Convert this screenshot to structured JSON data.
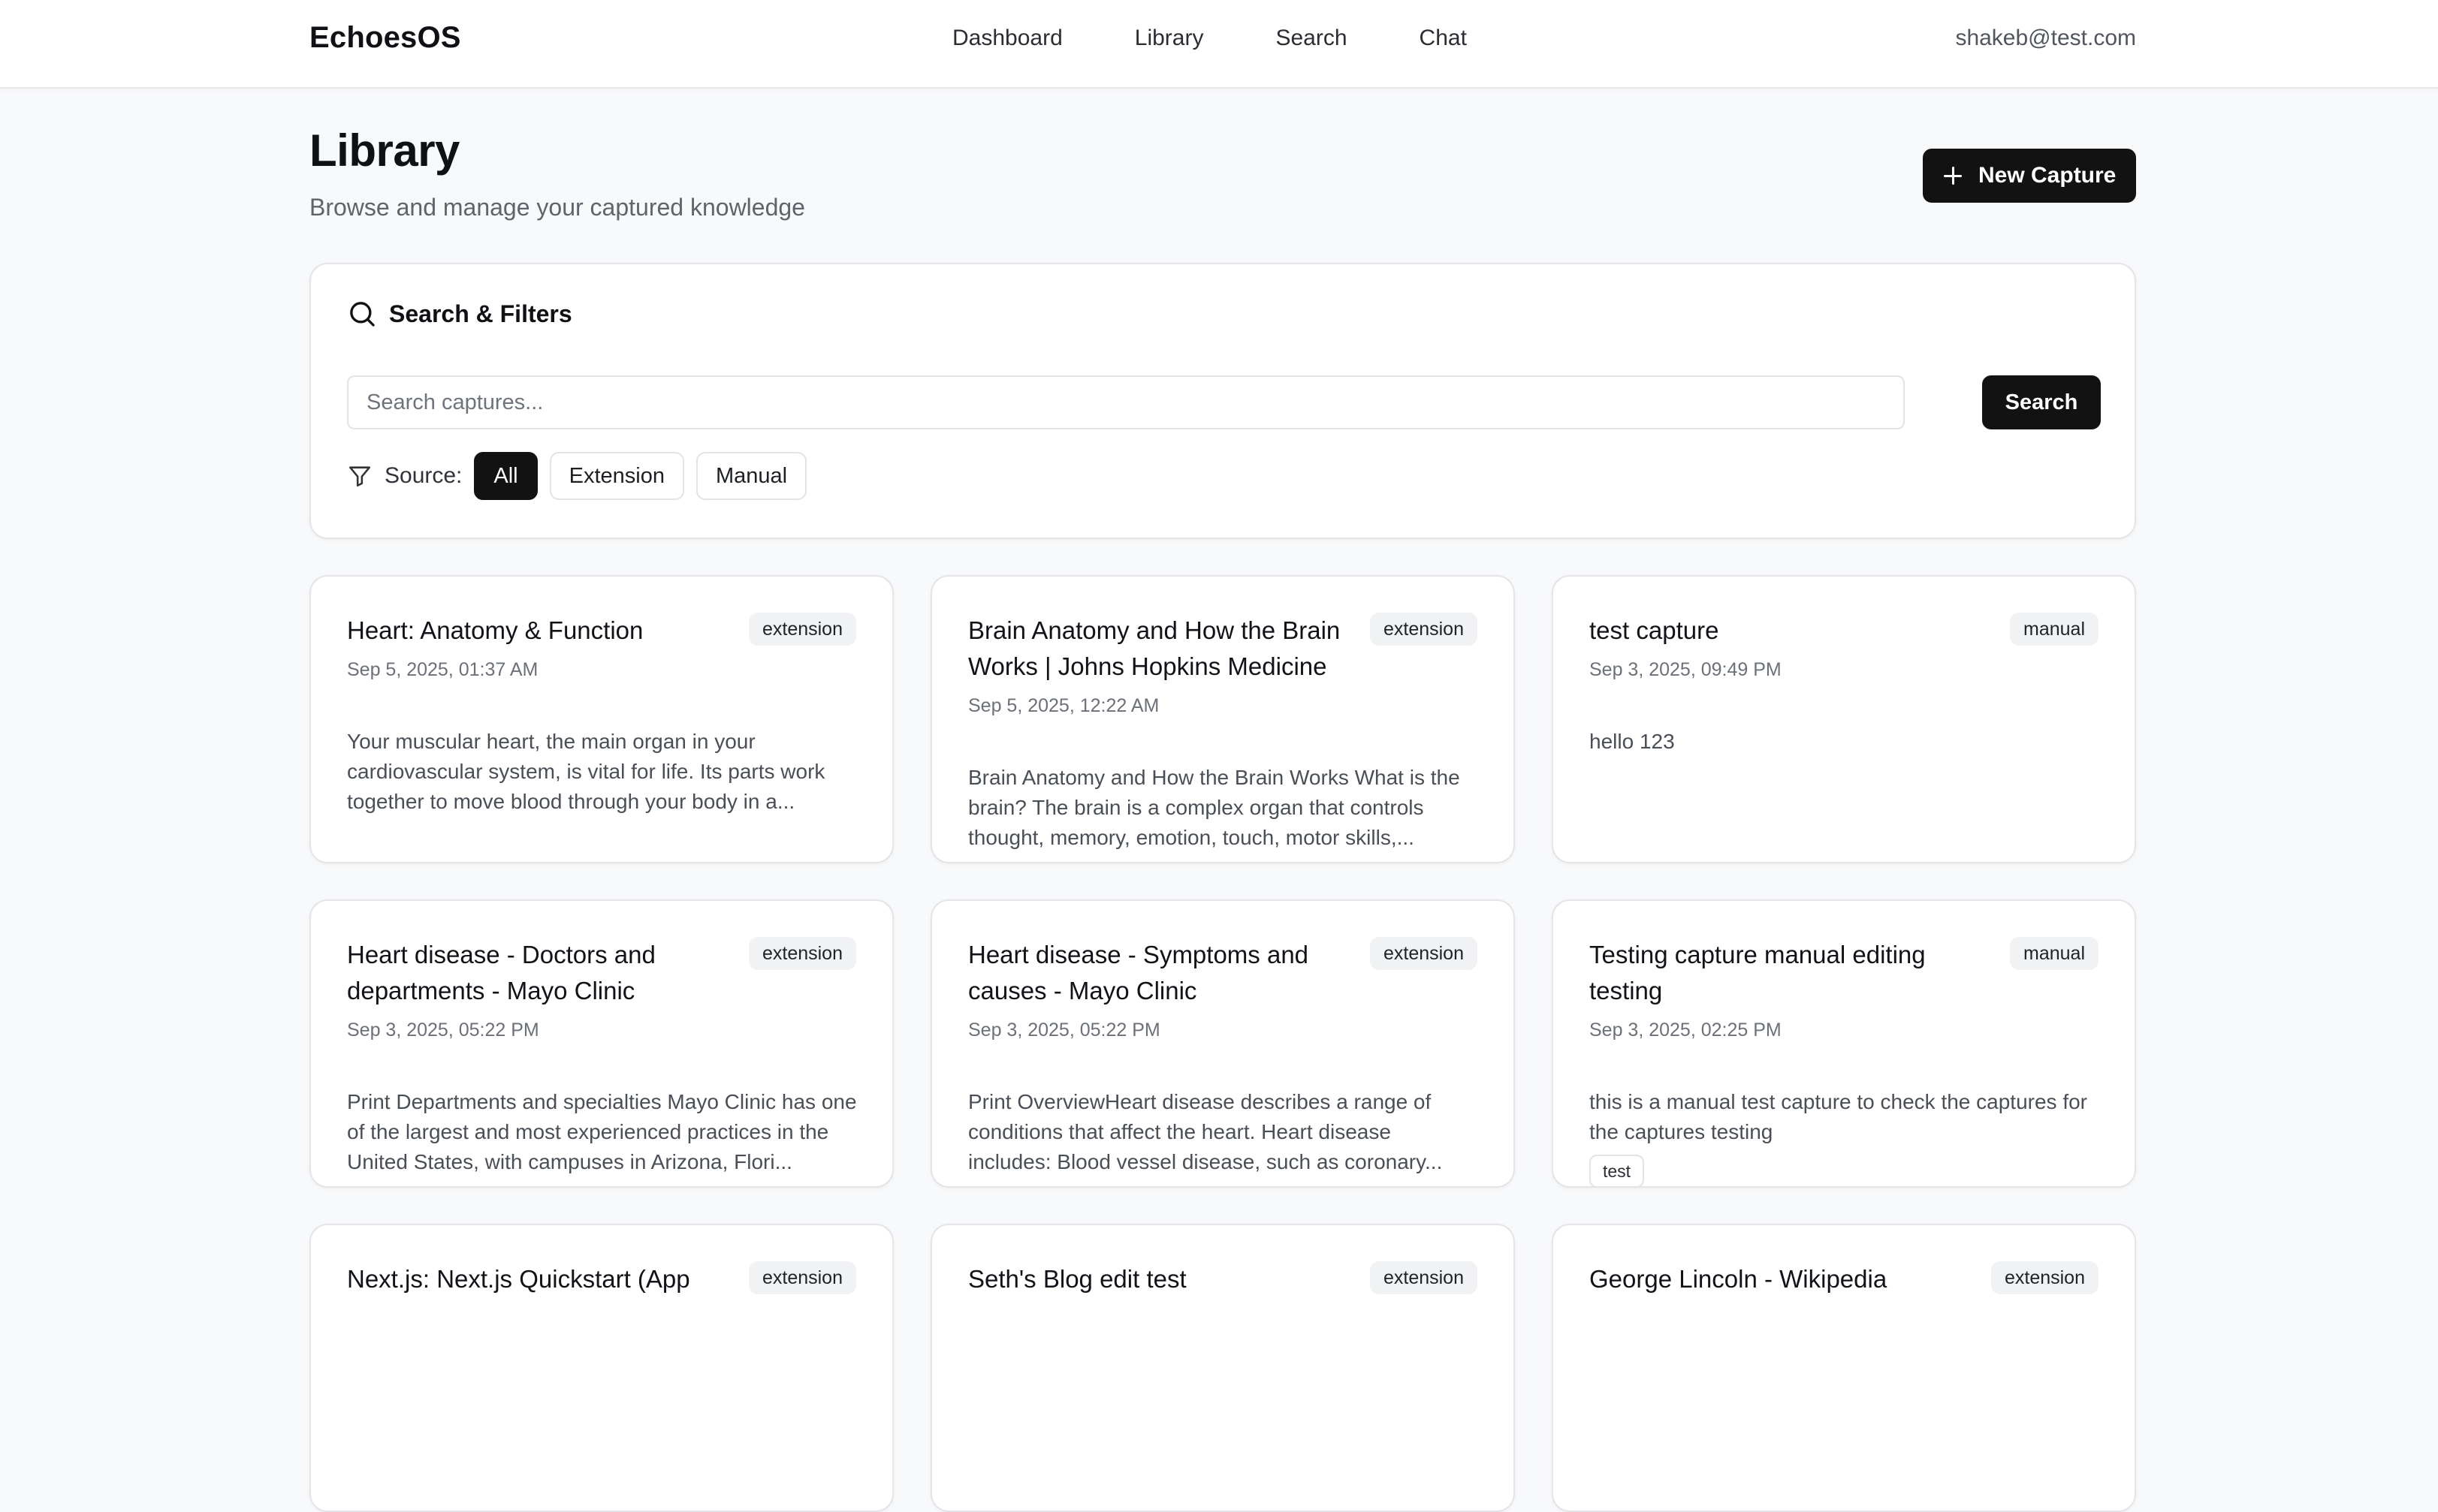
{
  "app": {
    "brand": "EchoesOS",
    "nav": [
      "Dashboard",
      "Library",
      "Search",
      "Chat"
    ],
    "user_email": "shakeb@test.com"
  },
  "page": {
    "title": "Library",
    "subtitle": "Browse and manage your captured knowledge",
    "new_capture_label": "New Capture"
  },
  "filters": {
    "title": "Search & Filters",
    "search_placeholder": "Search captures...",
    "search_button": "Search",
    "source_label": "Source:",
    "sources": [
      "All",
      "Extension",
      "Manual"
    ],
    "active_source": "All"
  },
  "captures": [
    {
      "title": "Heart: Anatomy & Function",
      "source": "extension",
      "date": "Sep 5, 2025, 01:37 AM",
      "excerpt": "Your muscular heart, the main organ in your cardiovascular system, is vital for life. Its parts work together to move blood through your body in a..."
    },
    {
      "title": "Brain Anatomy and How the Brain Works | Johns Hopkins Medicine",
      "source": "extension",
      "date": "Sep 5, 2025, 12:22 AM",
      "excerpt": "Brain Anatomy and How the Brain Works What is the brain? The brain is a complex organ that controls thought, memory, emotion, touch, motor skills,..."
    },
    {
      "title": "test capture",
      "source": "manual",
      "date": "Sep 3, 2025, 09:49 PM",
      "excerpt": "hello 123"
    },
    {
      "title": "Heart disease - Doctors and departments - Mayo Clinic",
      "source": "extension",
      "date": "Sep 3, 2025, 05:22 PM",
      "excerpt": "Print Departments and specialties Mayo Clinic has one of the largest and most experienced practices in the United States, with campuses in Arizona, Flori..."
    },
    {
      "title": "Heart disease - Symptoms and causes - Mayo Clinic",
      "source": "extension",
      "date": "Sep 3, 2025, 05:22 PM",
      "excerpt": "Print OverviewHeart disease describes a range of conditions that affect the heart. Heart disease includes: Blood vessel disease, such as coronary..."
    },
    {
      "title": "Testing capture manual editing testing",
      "source": "manual",
      "date": "Sep 3, 2025, 02:25 PM",
      "excerpt": "this is a manual test capture to check the captures for the captures testing",
      "tag": "test"
    },
    {
      "title": "Next.js: Next.js Quickstart (App",
      "source": "extension"
    },
    {
      "title": "Seth's Blog edit test",
      "source": "extension"
    },
    {
      "title": "George Lincoln - Wikipedia",
      "source": "extension"
    }
  ]
}
